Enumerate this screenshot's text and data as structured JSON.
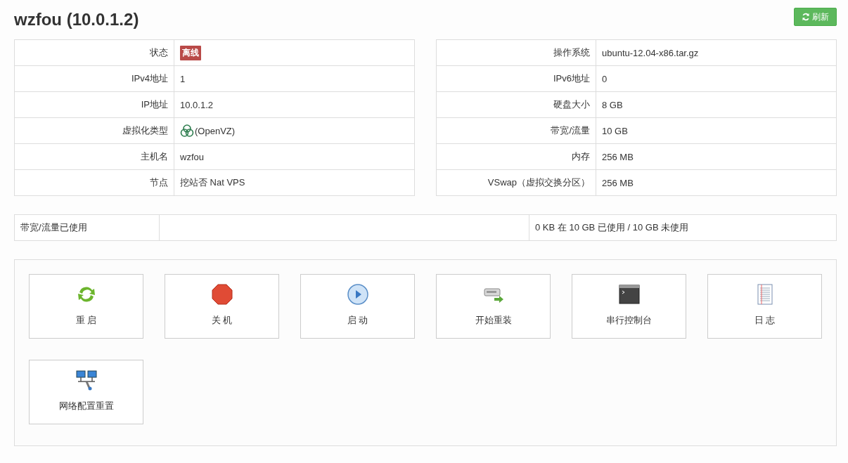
{
  "header": {
    "title": "wzfou (10.0.1.2)",
    "refresh_button": "刷新"
  },
  "info_left": [
    {
      "label": "状态",
      "value": "离线",
      "kind": "badge"
    },
    {
      "label": "IPv4地址",
      "value": "1",
      "kind": "text"
    },
    {
      "label": "IP地址",
      "value": "10.0.1.2",
      "kind": "text"
    },
    {
      "label": "虚拟化类型",
      "value": "(OpenVZ)",
      "kind": "logo"
    },
    {
      "label": "主机名",
      "value": "wzfou",
      "kind": "text"
    },
    {
      "label": "节点",
      "value": "挖站否 Nat VPS",
      "kind": "text"
    }
  ],
  "info_right": [
    {
      "label": "操作系统",
      "value": "ubuntu-12.04-x86.tar.gz",
      "kind": "text"
    },
    {
      "label": "IPv6地址",
      "value": "0",
      "kind": "text"
    },
    {
      "label": "硬盘大小",
      "value": "8 GB",
      "kind": "text"
    },
    {
      "label": "带宽/流量",
      "value": "10 GB",
      "kind": "text"
    },
    {
      "label": "内存",
      "value": "256 MB",
      "kind": "text"
    },
    {
      "label": "VSwap（虚拟交换分区）",
      "value": "256 MB",
      "kind": "text"
    }
  ],
  "bandwidth": {
    "label": "带宽/流量已使用",
    "summary": "0 KB 在 10 GB 已使用 / 10 GB 未使用"
  },
  "actions": [
    {
      "label": "重 启",
      "kind": "reboot"
    },
    {
      "label": "关 机",
      "kind": "shutdown"
    },
    {
      "label": "启 动",
      "kind": "boot"
    },
    {
      "label": "开始重装",
      "kind": "reinstall"
    },
    {
      "label": "串行控制台",
      "kind": "console"
    },
    {
      "label": "日 志",
      "kind": "log"
    },
    {
      "label": "网络配置重置",
      "kind": "network"
    }
  ]
}
